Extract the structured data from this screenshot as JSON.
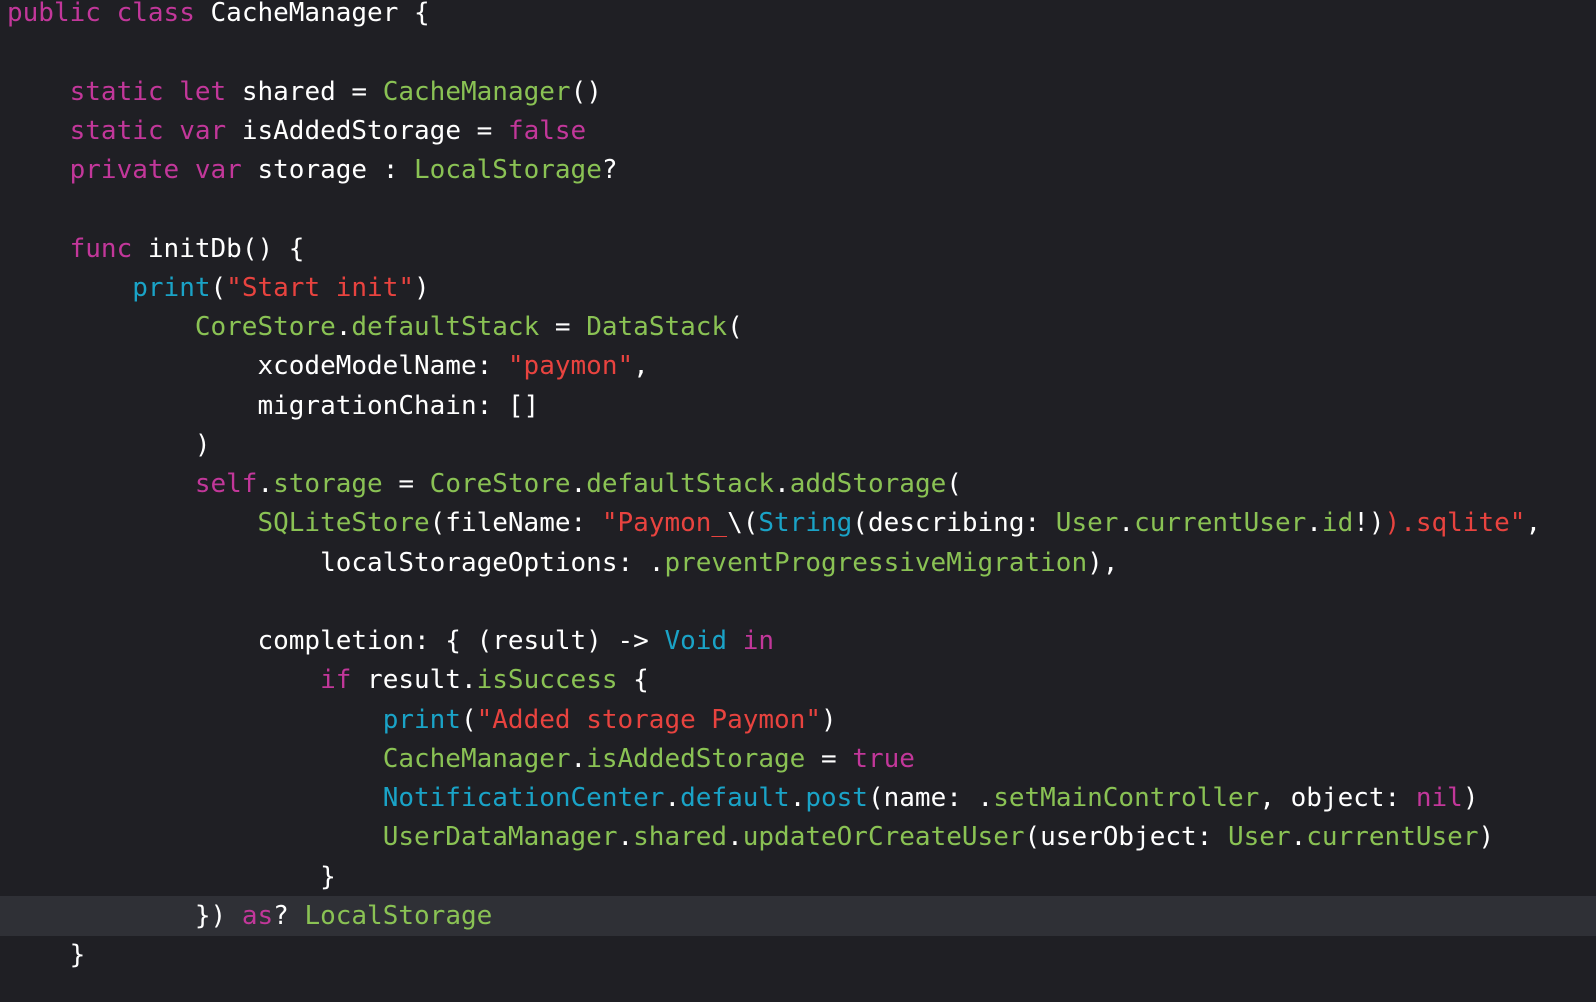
{
  "editor": {
    "lines": [
      [
        {
          "t": "public",
          "c": "kw"
        },
        {
          "t": " "
        },
        {
          "t": "class",
          "c": "kw"
        },
        {
          "t": " CacheManager {"
        }
      ],
      [],
      [
        {
          "t": "    "
        },
        {
          "t": "static",
          "c": "kw"
        },
        {
          "t": " "
        },
        {
          "t": "let",
          "c": "kw"
        },
        {
          "t": " shared = "
        },
        {
          "t": "CacheManager",
          "c": "green"
        },
        {
          "t": "()"
        }
      ],
      [
        {
          "t": "    "
        },
        {
          "t": "static",
          "c": "kw"
        },
        {
          "t": " "
        },
        {
          "t": "var",
          "c": "kw"
        },
        {
          "t": " isAddedStorage = "
        },
        {
          "t": "false",
          "c": "kw"
        }
      ],
      [
        {
          "t": "    "
        },
        {
          "t": "private",
          "c": "kw"
        },
        {
          "t": " "
        },
        {
          "t": "var",
          "c": "kw"
        },
        {
          "t": " storage : "
        },
        {
          "t": "LocalStorage",
          "c": "green"
        },
        {
          "t": "?"
        }
      ],
      [],
      [
        {
          "t": "    "
        },
        {
          "t": "func",
          "c": "kw"
        },
        {
          "t": " initDb() {"
        }
      ],
      [
        {
          "t": "        "
        },
        {
          "t": "print",
          "c": "sys"
        },
        {
          "t": "("
        },
        {
          "t": "\"Start init\"",
          "c": "str"
        },
        {
          "t": ")"
        }
      ],
      [
        {
          "t": "            "
        },
        {
          "t": "CoreStore",
          "c": "green"
        },
        {
          "t": "."
        },
        {
          "t": "defaultStack",
          "c": "green"
        },
        {
          "t": " = "
        },
        {
          "t": "DataStack",
          "c": "green"
        },
        {
          "t": "("
        }
      ],
      [
        {
          "t": "                xcodeModelName: "
        },
        {
          "t": "\"paymon\"",
          "c": "str"
        },
        {
          "t": ","
        }
      ],
      [
        {
          "t": "                migrationChain: []"
        }
      ],
      [
        {
          "t": "            )"
        }
      ],
      [
        {
          "t": "            "
        },
        {
          "t": "self",
          "c": "kw"
        },
        {
          "t": "."
        },
        {
          "t": "storage",
          "c": "green"
        },
        {
          "t": " = "
        },
        {
          "t": "CoreStore",
          "c": "green"
        },
        {
          "t": "."
        },
        {
          "t": "defaultStack",
          "c": "green"
        },
        {
          "t": "."
        },
        {
          "t": "addStorage",
          "c": "green"
        },
        {
          "t": "("
        }
      ],
      [
        {
          "t": "                "
        },
        {
          "t": "SQLiteStore",
          "c": "green"
        },
        {
          "t": "(fileName: "
        },
        {
          "t": "\"Paymon_",
          "c": "str"
        },
        {
          "t": "\\("
        },
        {
          "t": "String",
          "c": "sys"
        },
        {
          "t": "(describing: "
        },
        {
          "t": "User",
          "c": "green"
        },
        {
          "t": "."
        },
        {
          "t": "currentUser",
          "c": "green"
        },
        {
          "t": "."
        },
        {
          "t": "id",
          "c": "green"
        },
        {
          "t": "!)"
        },
        {
          "t": ").sqlite\"",
          "c": "str"
        },
        {
          "t": ","
        }
      ],
      [
        {
          "t": "                    localStorageOptions: ."
        },
        {
          "t": "preventProgressiveMigration",
          "c": "green"
        },
        {
          "t": "),"
        }
      ],
      [],
      [
        {
          "t": "                completion: { (result) -> "
        },
        {
          "t": "Void",
          "c": "sys"
        },
        {
          "t": " "
        },
        {
          "t": "in",
          "c": "kw"
        }
      ],
      [
        {
          "t": "                    "
        },
        {
          "t": "if",
          "c": "kw"
        },
        {
          "t": " result."
        },
        {
          "t": "isSuccess",
          "c": "green"
        },
        {
          "t": " {"
        }
      ],
      [
        {
          "t": "                        "
        },
        {
          "t": "print",
          "c": "sys"
        },
        {
          "t": "("
        },
        {
          "t": "\"Added storage Paymon\"",
          "c": "str"
        },
        {
          "t": ")"
        }
      ],
      [
        {
          "t": "                        "
        },
        {
          "t": "CacheManager",
          "c": "green"
        },
        {
          "t": "."
        },
        {
          "t": "isAddedStorage",
          "c": "green"
        },
        {
          "t": " = "
        },
        {
          "t": "true",
          "c": "kw"
        }
      ],
      [
        {
          "t": "                        "
        },
        {
          "t": "NotificationCenter",
          "c": "sys"
        },
        {
          "t": "."
        },
        {
          "t": "default",
          "c": "sys"
        },
        {
          "t": "."
        },
        {
          "t": "post",
          "c": "sys"
        },
        {
          "t": "(name: ."
        },
        {
          "t": "setMainController",
          "c": "green"
        },
        {
          "t": ", object: "
        },
        {
          "t": "nil",
          "c": "kw"
        },
        {
          "t": ")"
        }
      ],
      [
        {
          "t": "                        "
        },
        {
          "t": "UserDataManager",
          "c": "green"
        },
        {
          "t": "."
        },
        {
          "t": "shared",
          "c": "green"
        },
        {
          "t": "."
        },
        {
          "t": "updateOrCreateUser",
          "c": "green"
        },
        {
          "t": "(userObject: "
        },
        {
          "t": "User",
          "c": "green"
        },
        {
          "t": "."
        },
        {
          "t": "currentUser",
          "c": "green"
        },
        {
          "t": ")"
        }
      ],
      [
        {
          "t": "                    }"
        }
      ],
      [
        {
          "t": "            }) "
        },
        {
          "t": "as",
          "c": "kw"
        },
        {
          "t": "? "
        },
        {
          "t": "LocalStorage",
          "c": "green"
        }
      ],
      [
        {
          "t": "    }"
        }
      ]
    ],
    "current_line": 23
  },
  "colors": {
    "background": "#1f1f24",
    "current_line": "#2f3036",
    "keyword": "#c2379a",
    "type_and_member": "#8ac254",
    "string": "#e8433f",
    "system": "#1aa3c7",
    "plain": "#ffffff"
  }
}
